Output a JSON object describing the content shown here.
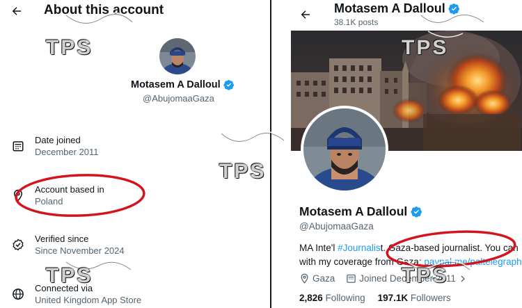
{
  "left": {
    "title": "About this account",
    "name": "Motasem A Dalloul",
    "handle": "@AbujomaaGaza",
    "rows": [
      {
        "label": "Date joined",
        "value": "December 2011",
        "icon": "calendar-icon"
      },
      {
        "label": "Account based in",
        "value": "Poland",
        "icon": "location-pin-icon"
      },
      {
        "label": "Verified since",
        "value": "Since November 2024",
        "icon": "verified-check-icon"
      },
      {
        "label": "Connected via",
        "value": "United Kingdom App Store",
        "icon": "globe-icon"
      }
    ]
  },
  "right": {
    "header_name": "Motasem A Dalloul",
    "posts": "38.1K posts",
    "name": "Motasem A Dalloul",
    "handle": "@AbujomaaGaza",
    "bio": {
      "prefix": "MA Inte'l ",
      "hashtag": "#Journalis",
      "middle": "t. Gaza-based journalist. You can",
      "line2_prefix": "with my coverage from Gaza: ",
      "line2_link": "paypal.me/paltelegraph"
    },
    "location": "Gaza",
    "joined": "Joined December 2011",
    "following_count": "2,826",
    "following_label": "Following",
    "followers_count": "197.1K",
    "followers_label": "Followers"
  },
  "watermark": "TPS",
  "colors": {
    "accent": "#1d9bf0",
    "annotation_red": "#d4141c",
    "text_secondary": "#536471"
  }
}
